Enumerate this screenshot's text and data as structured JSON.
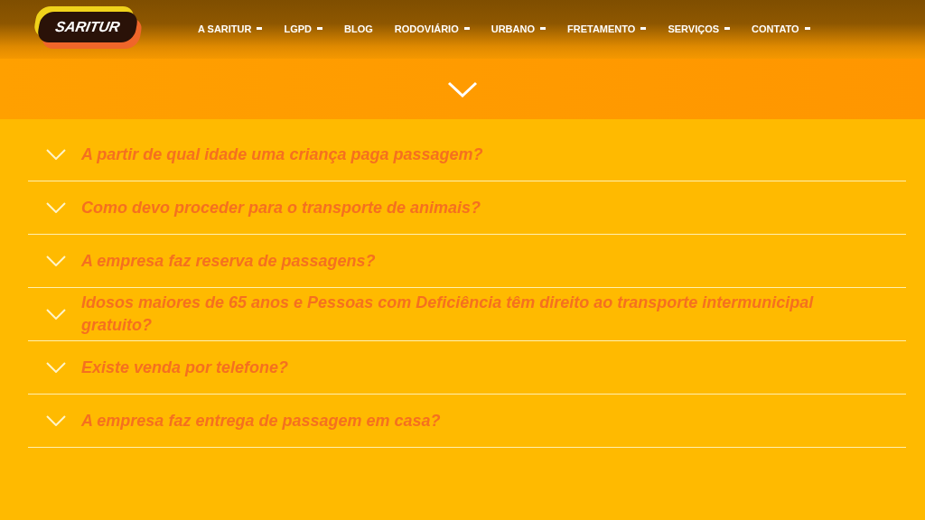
{
  "logo": {
    "text": "SARITUR"
  },
  "nav": [
    {
      "label": "A SARITUR",
      "dropdown": true
    },
    {
      "label": "LGPD",
      "dropdown": true
    },
    {
      "label": "BLOG",
      "dropdown": false
    },
    {
      "label": "RODOVIÁRIO",
      "dropdown": true
    },
    {
      "label": "URBANO",
      "dropdown": true
    },
    {
      "label": "FRETAMENTO",
      "dropdown": true
    },
    {
      "label": "SERVIÇOS",
      "dropdown": true
    },
    {
      "label": "CONTATO",
      "dropdown": true
    }
  ],
  "faq": [
    {
      "question": "A partir de qual idade uma criança paga passagem?",
      "expanded": false
    },
    {
      "question": "Como devo proceder para o transporte de animais?",
      "expanded": false
    },
    {
      "question": "A empresa faz reserva de passagens?",
      "expanded": false
    },
    {
      "question": "Idosos maiores de 65 anos e Pessoas com Deficiência têm direito ao transporte intermunicipal gratuito?",
      "expanded": false
    },
    {
      "question": "Existe venda por telefone?",
      "expanded": false
    },
    {
      "question": "A empresa faz entrega de passagem em casa?",
      "expanded": false
    }
  ]
}
